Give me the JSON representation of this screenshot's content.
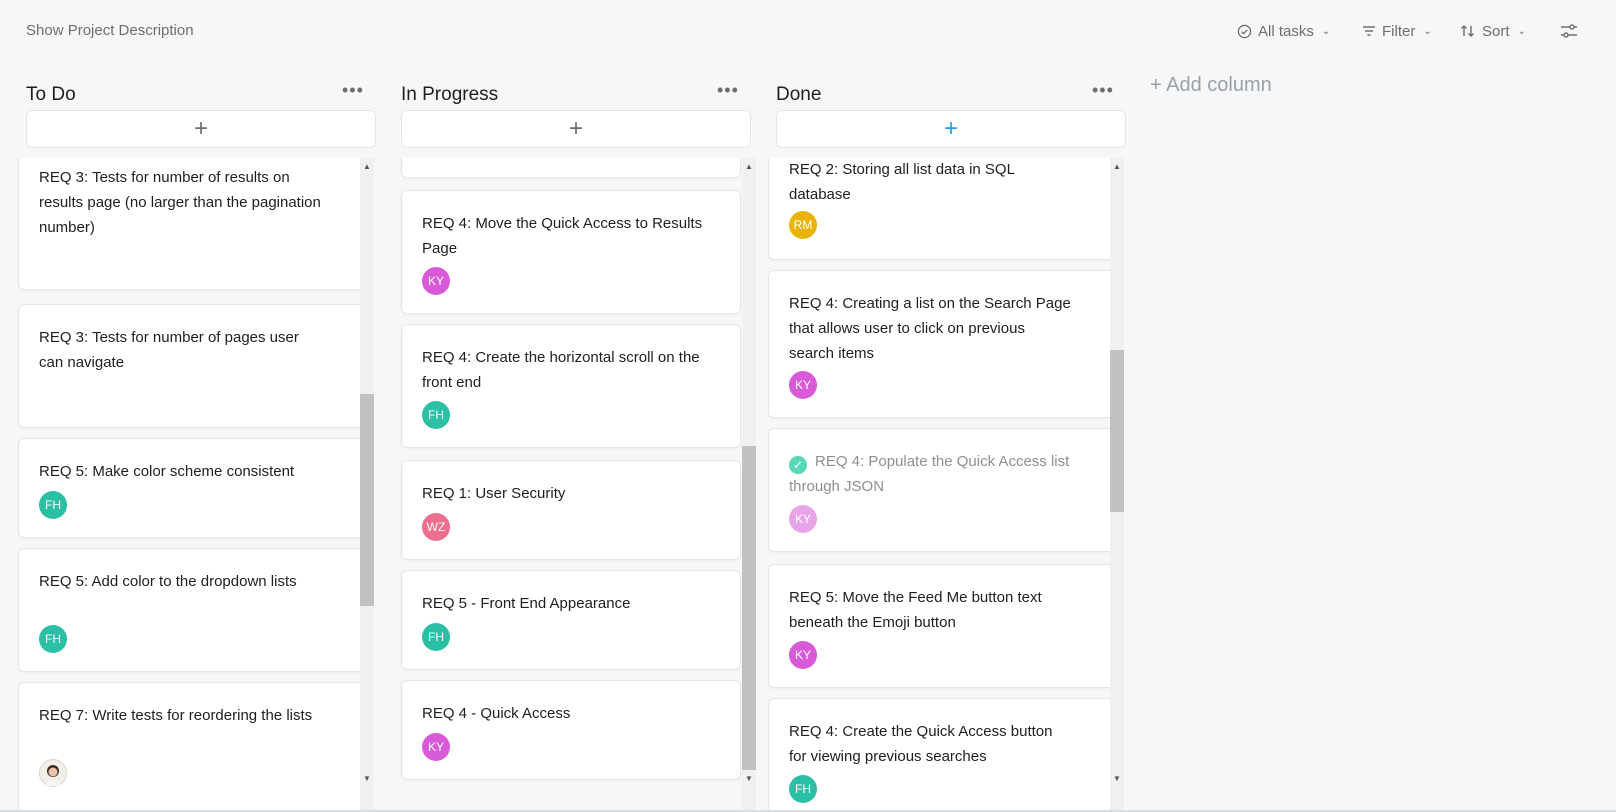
{
  "toolbar": {
    "show_description": "Show Project Description",
    "all_tasks": "All tasks",
    "filter": "Filter",
    "sort": "Sort"
  },
  "add_column": "+ Add column",
  "columns": [
    {
      "title": "To Do",
      "cards": [
        {
          "title": "REQ 3: Tests for number of results on results page (no larger than the pagination number)",
          "avatar": ""
        },
        {
          "title": "REQ 3: Tests for number of pages user can navigate",
          "avatar": ""
        },
        {
          "title": "REQ 5: Make color scheme consistent",
          "avatar": "FH"
        },
        {
          "title": "REQ 5: Add color to the dropdown lists",
          "avatar": "FH"
        },
        {
          "title": "REQ 7: Write tests for reordering the lists",
          "avatar": ""
        }
      ]
    },
    {
      "title": "In Progress",
      "cards": [
        {
          "title": "REQ 4: Move the Quick Access to Results Page",
          "avatar": "KY"
        },
        {
          "title": "REQ 4: Create the horizontal scroll on the front end",
          "avatar": "FH"
        },
        {
          "title": "REQ 1: User Security",
          "avatar": "WZ"
        },
        {
          "title": "REQ 5 - Front End Appearance",
          "avatar": "FH"
        },
        {
          "title": "REQ 4 - Quick Access",
          "avatar": "KY"
        }
      ]
    },
    {
      "title": "Done",
      "cards": [
        {
          "title": "REQ 2: Storing all list data in SQL database",
          "avatar": "RM"
        },
        {
          "title": "REQ 4: Creating a list on the Search Page that allows user to click on previous search items",
          "avatar": "KY"
        },
        {
          "title": "REQ 4: Populate the Quick Access list through JSON",
          "avatar": "KY"
        },
        {
          "title": "REQ 5: Move the Feed Me button text beneath the Emoji button",
          "avatar": "KY"
        },
        {
          "title": "REQ 4: Create the Quick Access button for viewing previous searches",
          "avatar": "FH"
        }
      ]
    }
  ],
  "colors": {
    "FH": "#2bbfa4",
    "KY": "#d85ad8",
    "WZ": "#ec6f8e",
    "RM": "#eab308",
    "accent": "#1da1f2"
  }
}
